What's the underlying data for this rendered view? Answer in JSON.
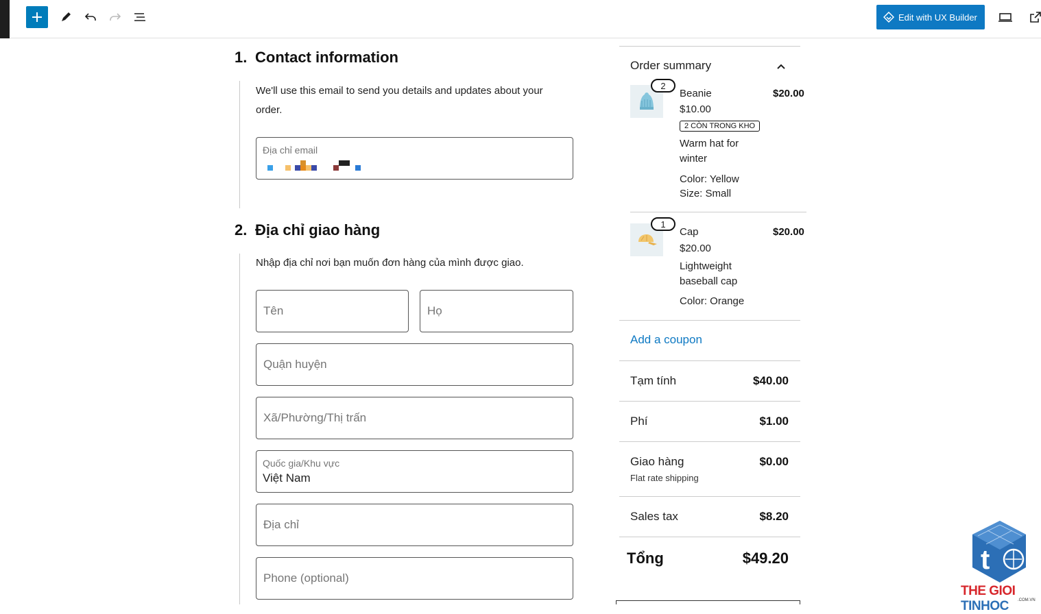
{
  "toolbar": {
    "ux_builder_label": "Edit with UX Builder"
  },
  "contact": {
    "number": "1.",
    "title": "Contact information",
    "description": "We'll use this email to send you details and updates about your order.",
    "email_label": "Địa chỉ email"
  },
  "shipping": {
    "number": "2.",
    "title": "Địa chỉ giao hàng",
    "description": "Nhập địa chỉ nơi bạn muốn đơn hàng của mình được giao.",
    "first_name_placeholder": "Tên",
    "last_name_placeholder": "Họ",
    "district_placeholder": "Quận huyện",
    "ward_placeholder": "Xã/Phường/Thị trấn",
    "country_label": "Quốc gia/Khu vực",
    "country_value": "Việt Nam",
    "address_placeholder": "Địa chỉ",
    "phone_placeholder": "Phone (optional)"
  },
  "summary": {
    "title": "Order summary",
    "items": [
      {
        "qty": "2",
        "name": "Beanie",
        "unit_price": "$10.00",
        "stock_badge": "2 CÒN TRONG KHO",
        "desc_line1": "Warm hat for",
        "desc_line2": "winter",
        "attr1": "Color: Yellow",
        "attr2": "Size: Small",
        "total": "$20.00"
      },
      {
        "qty": "1",
        "name": "Cap",
        "unit_price": "$20.00",
        "desc_line1": "Lightweight",
        "desc_line2": "baseball cap",
        "attr1": "Color: Orange",
        "total": "$20.00"
      }
    ],
    "coupon_label": "Add a coupon",
    "subtotal_label": "Tạm tính",
    "subtotal_value": "$40.00",
    "fee_label": "Phí",
    "fee_value": "$1.00",
    "shipping_label": "Giao hàng",
    "shipping_value": "$0.00",
    "shipping_method": "Flat rate shipping",
    "tax_label": "Sales tax",
    "tax_value": "$8.20",
    "total_label": "Tổng",
    "total_value": "$49.20"
  },
  "logo": {
    "text_the": "THE GIOI",
    "text_tinhoc": "TINHOC",
    "domain": ".COM.VN"
  },
  "colors": {
    "accent": "#007cba",
    "link": "#0e79c3",
    "logo_red": "#d7262b",
    "logo_blue": "#2c6fb6"
  }
}
